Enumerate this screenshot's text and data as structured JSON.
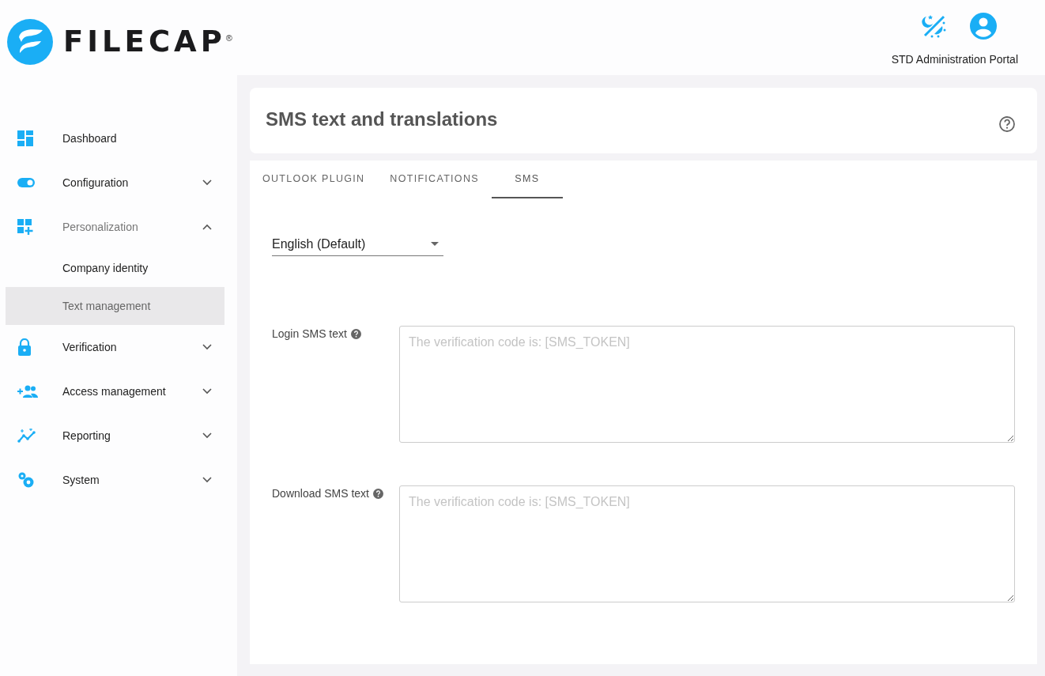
{
  "logo": {
    "name": "FILECAP",
    "mark": "®"
  },
  "header": {
    "portal": "STD Administration Portal"
  },
  "sidebar": {
    "items": [
      {
        "label": "Dashboard"
      },
      {
        "label": "Configuration",
        "expanded": false
      },
      {
        "label": "Personalization",
        "expanded": true,
        "children": [
          {
            "label": "Company identity",
            "selected": false
          },
          {
            "label": "Text management",
            "selected": true
          }
        ]
      },
      {
        "label": "Verification",
        "expanded": false
      },
      {
        "label": "Access management",
        "expanded": false
      },
      {
        "label": "Reporting",
        "expanded": false
      },
      {
        "label": "System",
        "expanded": false
      }
    ]
  },
  "page": {
    "title": "SMS text and translations"
  },
  "tabs": [
    {
      "label": "OUTLOOK PLUGIN",
      "selected": false
    },
    {
      "label": "NOTIFICATIONS",
      "selected": false
    },
    {
      "label": "SMS",
      "selected": true
    }
  ],
  "language": {
    "value": "English (Default)"
  },
  "fields": [
    {
      "label": "Login SMS text",
      "placeholder": "The verification code is: [SMS_TOKEN]"
    },
    {
      "label": "Download SMS text",
      "placeholder": "The verification code is: [SMS_TOKEN]"
    }
  ]
}
